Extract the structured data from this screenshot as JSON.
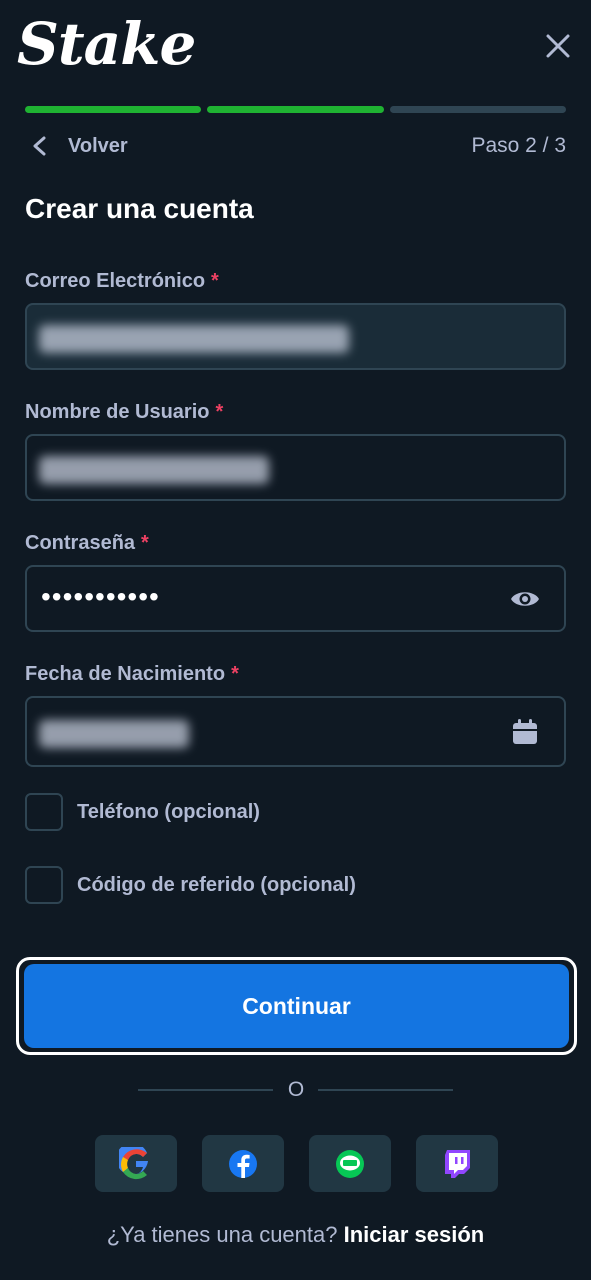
{
  "header": {
    "logo_text": "Stake"
  },
  "progress": {
    "current_step": 2,
    "total_steps": 3
  },
  "nav": {
    "back_label": "Volver",
    "step_label": "Paso 2 / 3"
  },
  "form": {
    "title": "Crear una cuenta",
    "required_marker": "*",
    "email": {
      "label": "Correo Electrónico",
      "value_redacted": true
    },
    "username": {
      "label": "Nombre de Usuario",
      "value_redacted": true
    },
    "password": {
      "label": "Contraseña",
      "masked_value": "•••••••••••"
    },
    "birthdate": {
      "label": "Fecha de Nacimiento",
      "value_redacted": true
    },
    "phone_option": {
      "label": "Teléfono (opcional)",
      "checked": false
    },
    "referral_option": {
      "label": "Código de referido (opcional)",
      "checked": false
    },
    "submit_label": "Continuar"
  },
  "separator": {
    "label": "O"
  },
  "social": [
    "google-icon",
    "facebook-icon",
    "line-icon",
    "twitch-icon"
  ],
  "footer": {
    "prompt": "¿Ya tienes una cuenta?",
    "login_label": "Iniciar sesión"
  },
  "colors": {
    "background": "#0f1923",
    "field_filled": "#1a2c38",
    "border": "#2f4553",
    "progress_active": "#1fb232",
    "primary_button": "#1475e1",
    "required": "#ed4163"
  }
}
